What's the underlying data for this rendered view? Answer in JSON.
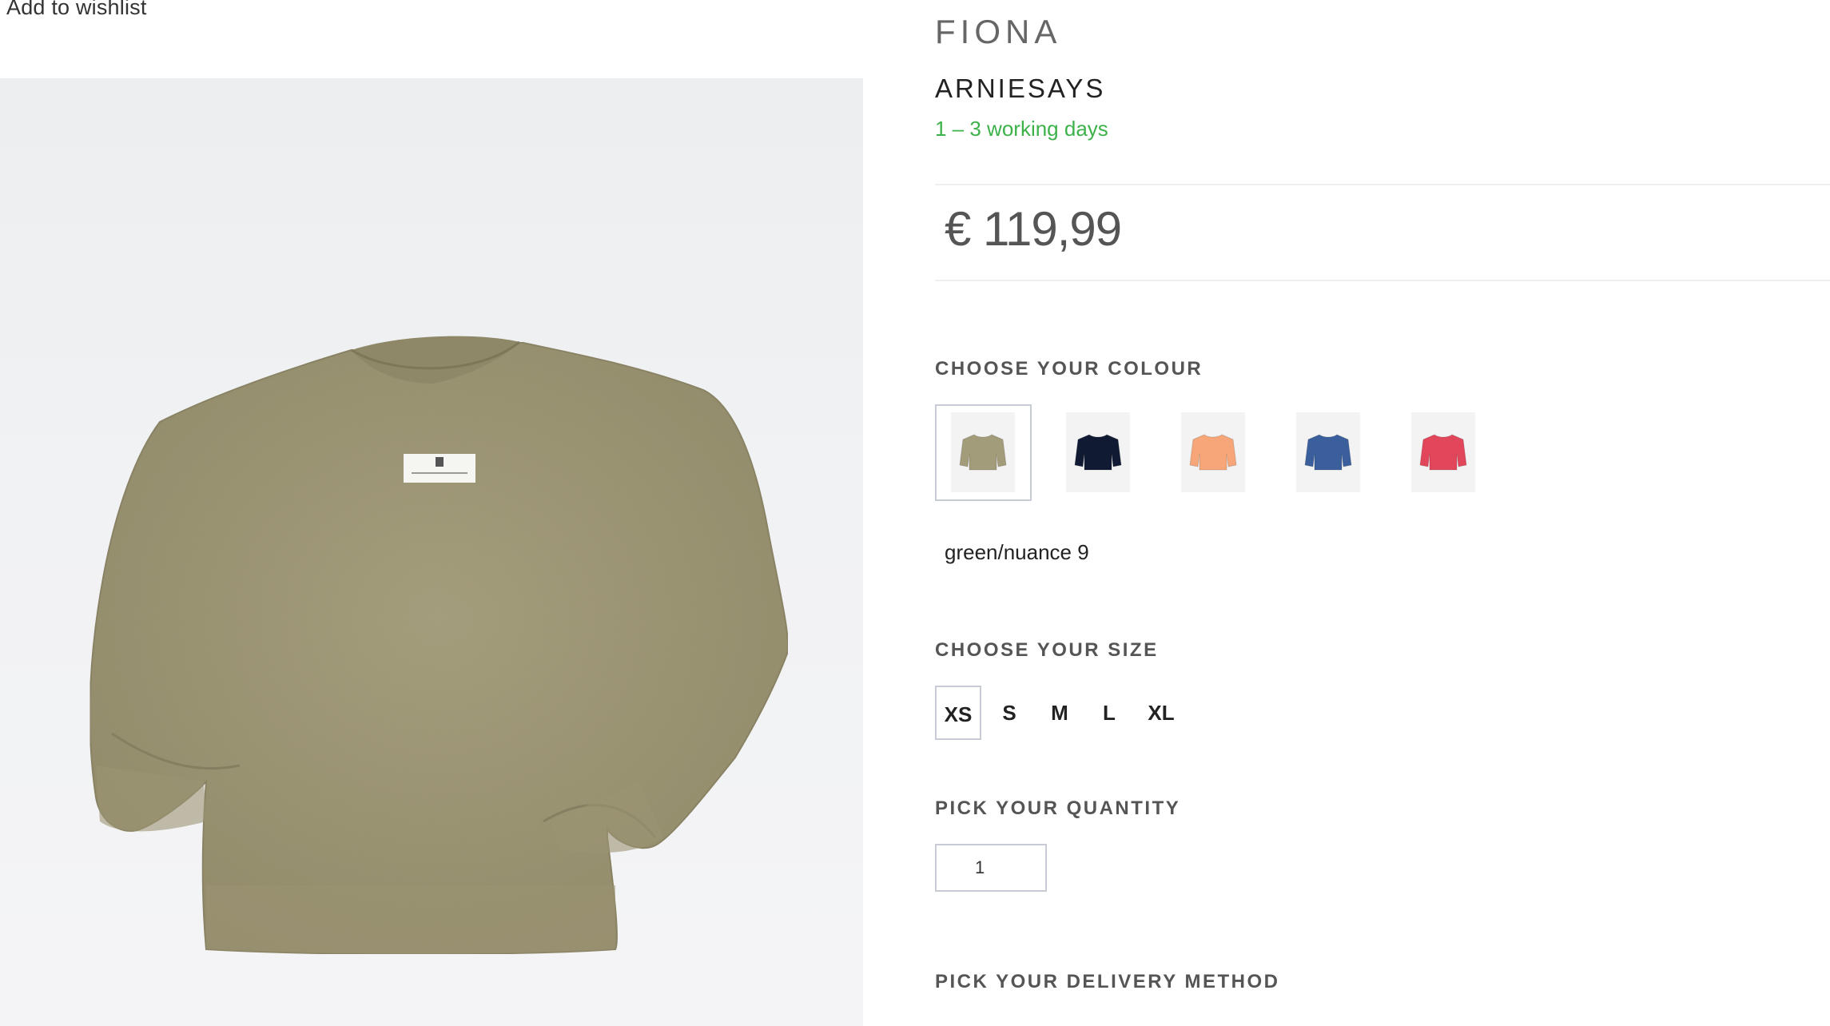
{
  "wishlist": {
    "label": "Add to wishlist"
  },
  "product": {
    "title": "FIONA",
    "brand": "ARNIESAYS",
    "delivery_time": "1 – 3 working days",
    "price": "€ 119,99"
  },
  "colour": {
    "heading": "CHOOSE YOUR COLOUR",
    "selected_name": "green/nuance 9",
    "swatches": [
      {
        "name": "green",
        "color": "#a39c7a"
      },
      {
        "name": "navy",
        "color": "#111a33"
      },
      {
        "name": "peach",
        "color": "#f6a678"
      },
      {
        "name": "blue",
        "color": "#3b5f9c"
      },
      {
        "name": "red",
        "color": "#e2465a"
      }
    ]
  },
  "size": {
    "heading": "CHOOSE YOUR SIZE",
    "options": [
      "XS",
      "S",
      "M",
      "L",
      "XL"
    ],
    "selected": "XS"
  },
  "quantity": {
    "heading": "PICK YOUR QUANTITY",
    "value": "1"
  },
  "delivery_method": {
    "heading": "PICK YOUR DELIVERY METHOD"
  },
  "colors": {
    "delivery_green": "#3db24a",
    "sweater_main": "#a39c7a"
  }
}
